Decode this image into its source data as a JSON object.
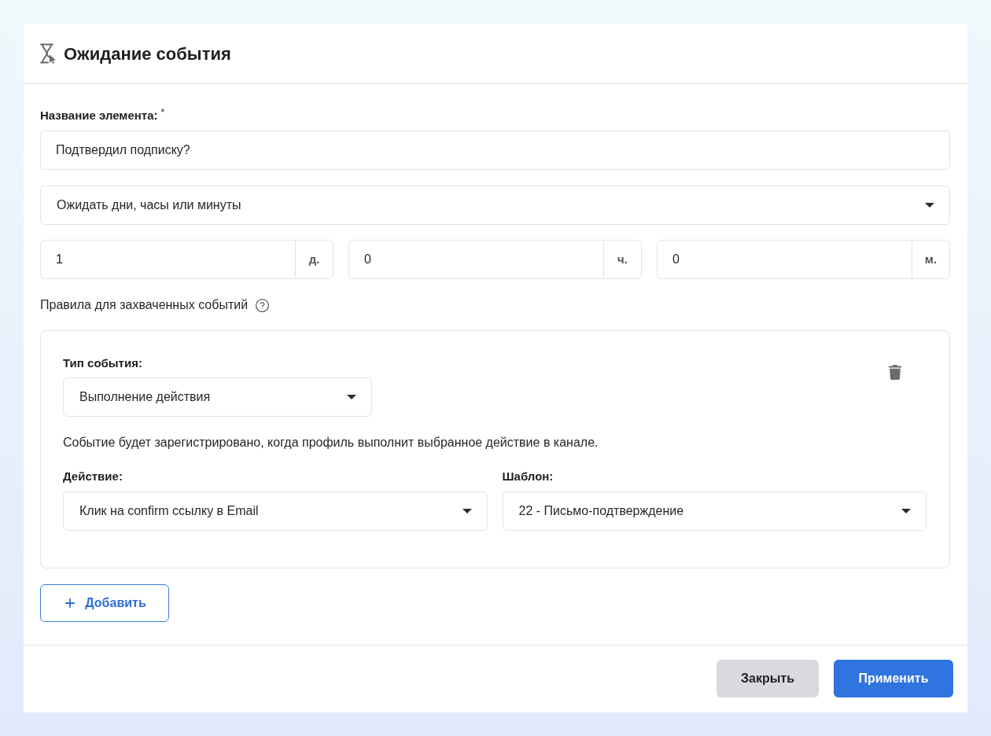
{
  "dialog": {
    "title": "Ожидание события"
  },
  "name_field": {
    "label": "Название элемента:",
    "required_mark": "*",
    "value": "Подтвердил подписку?"
  },
  "wait_mode_select": {
    "value": "Ожидать дни, часы или минуты"
  },
  "duration_fields": [
    {
      "value": "1",
      "unit": "д."
    },
    {
      "value": "0",
      "unit": "ч."
    },
    {
      "value": "0",
      "unit": "м."
    }
  ],
  "rules_heading": {
    "text": "Правила для захваченных событий"
  },
  "rules": [
    {
      "event_type_label": "Тип события:",
      "event_type": "Выполнение действия",
      "description": "Событие будет зарегистрировано, когда профиль выполнит выбранное действие в канале.",
      "action_label": "Действие:",
      "action": "Клик на confirm ссылку в Email",
      "template_label": "Шаблон:",
      "template": "22 - Письмо-подтверждение"
    }
  ],
  "add_button": {
    "label": "Добавить"
  },
  "footer_buttons": [
    {
      "label": "Закрыть",
      "kind": "secondary"
    },
    {
      "label": "Применить",
      "kind": "primary"
    }
  ]
}
